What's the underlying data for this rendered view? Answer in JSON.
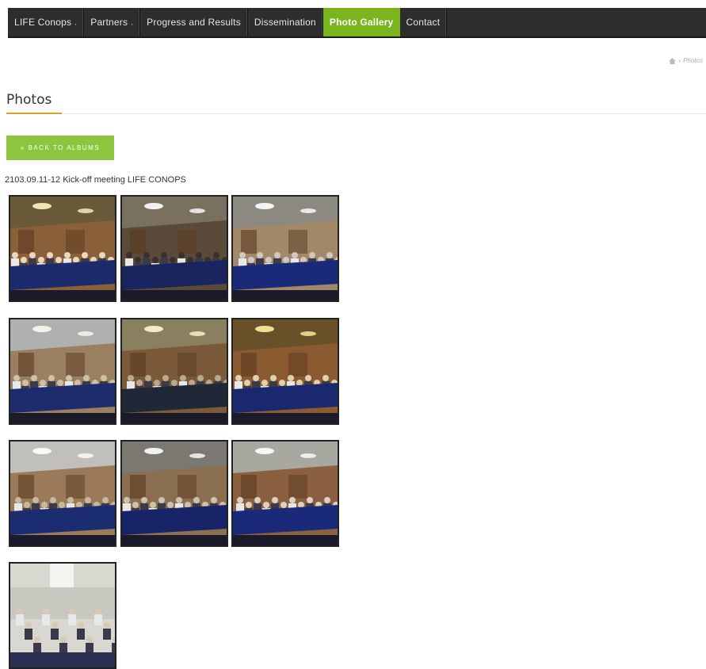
{
  "nav": {
    "items": [
      {
        "label": "LIFE Conops",
        "has_dropdown": true
      },
      {
        "label": "Partners",
        "has_dropdown": true
      },
      {
        "label": "Progress and Results",
        "has_dropdown": false
      },
      {
        "label": "Dissemination",
        "has_dropdown": false
      },
      {
        "label": "Photo Gallery",
        "has_dropdown": false,
        "active": true
      },
      {
        "label": "Contact",
        "has_dropdown": false
      }
    ],
    "accent_color": "#7ab51d"
  },
  "breadcrumb": {
    "home_icon": "home-icon",
    "current": "Photos"
  },
  "page": {
    "title": "Photos"
  },
  "back_button": {
    "label": "« BACK TO ALBUMS",
    "color": "#8cc63f"
  },
  "album": {
    "title": "2103.09.11-12 Kick-off meeting LIFE CONOPS",
    "photo_count": 10
  }
}
